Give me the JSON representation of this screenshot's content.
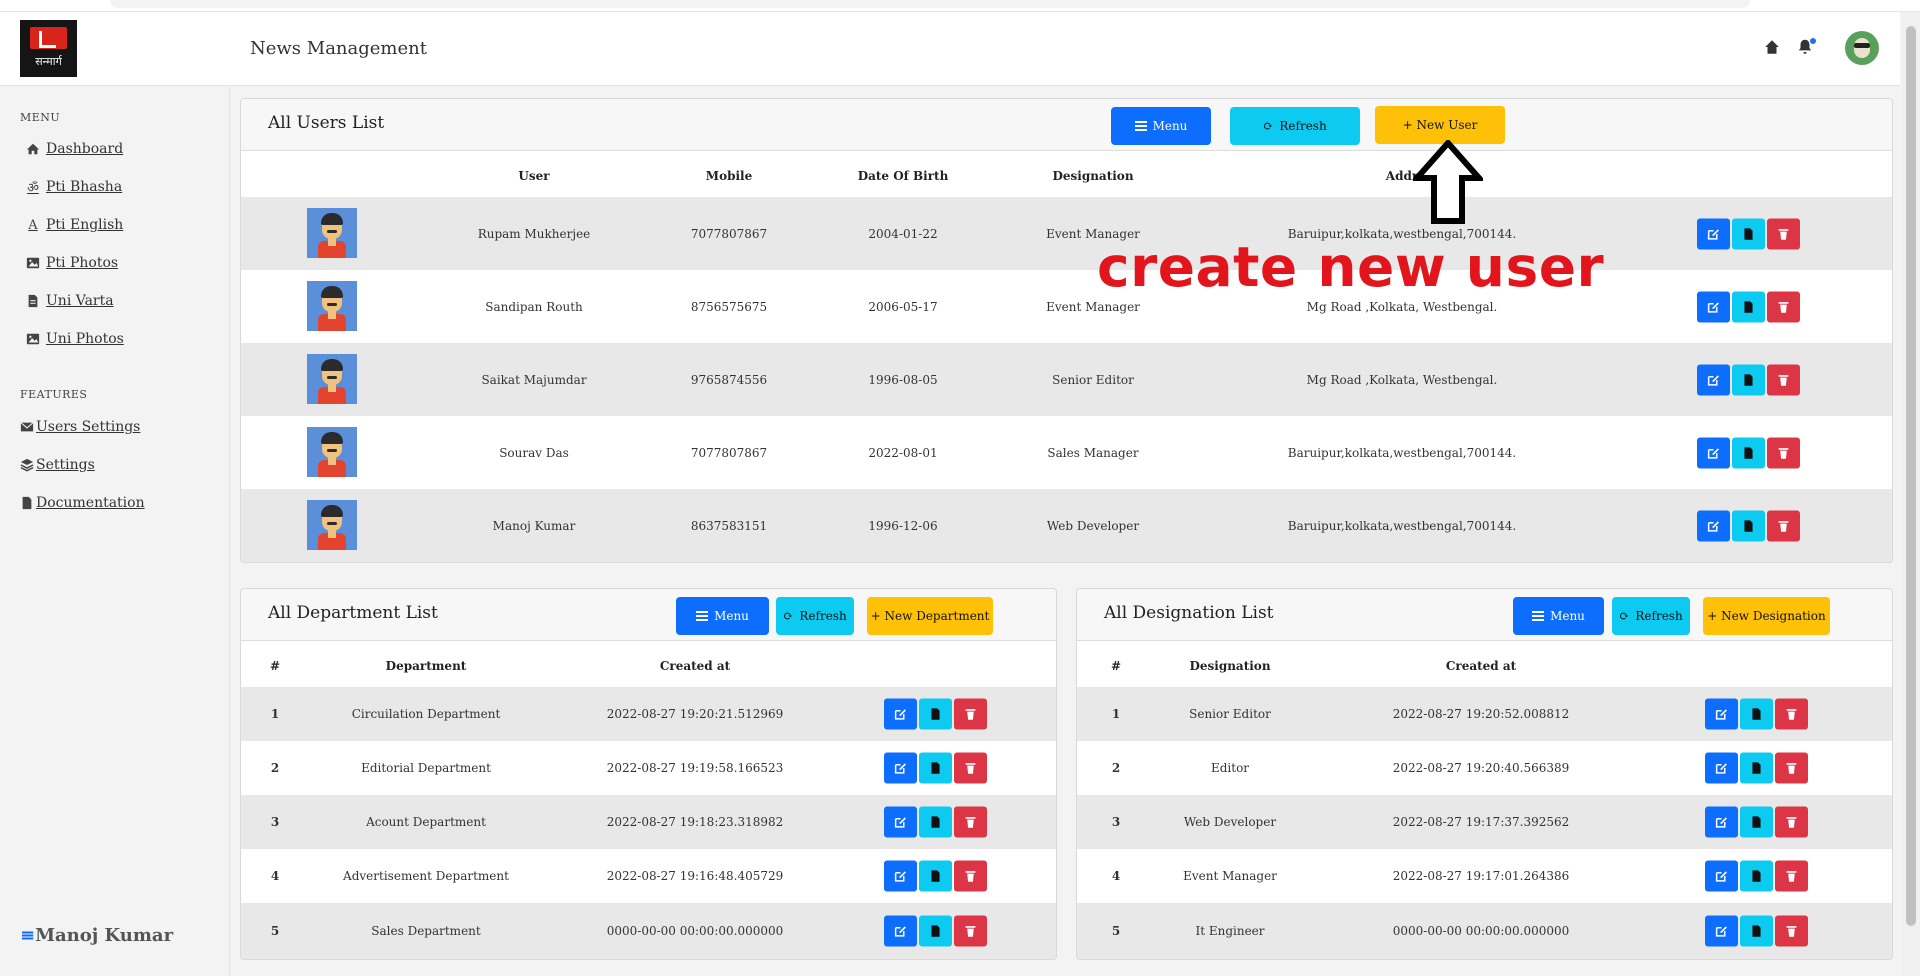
{
  "header": {
    "title": "News Management",
    "logo_text": "सन्मार्ग"
  },
  "sidebar": {
    "menu_label": "MENU",
    "menu_items": [
      {
        "label": "Dashboard",
        "icon": "home-icon"
      },
      {
        "label": "Pti Bhasha",
        "icon": "om-icon"
      },
      {
        "label": "Pti English",
        "icon": "letter-a-icon"
      },
      {
        "label": "Pti Photos",
        "icon": "image-icon"
      },
      {
        "label": "Uni Varta",
        "icon": "file-icon"
      },
      {
        "label": "Uni Photos",
        "icon": "image-icon"
      }
    ],
    "features_label": "FEATURES",
    "feature_items": [
      {
        "label": "Users Settings",
        "icon": "envelope-icon"
      },
      {
        "label": "Settings",
        "icon": "layers-icon"
      },
      {
        "label": "Documentation",
        "icon": "file-icon"
      }
    ],
    "footer_user": "Manoj Kumar",
    "footer_icon": "≡"
  },
  "users_card": {
    "title": "All Users List",
    "menu_btn": "Menu",
    "refresh_btn": "Refresh",
    "new_btn": "+ New User",
    "columns": [
      "User",
      "Mobile",
      "Date Of Birth",
      "Designation",
      "Addr"
    ],
    "rows": [
      {
        "name": "Rupam Mukherjee",
        "mobile": "7077807867",
        "dob": "2004-01-22",
        "designation": "Event Manager",
        "address": "Baruipur,kolkata,westbengal,700144."
      },
      {
        "name": "Sandipan Routh",
        "mobile": "8756575675",
        "dob": "2006-05-17",
        "designation": "Event Manager",
        "address": "Mg Road ,Kolkata, Westbengal."
      },
      {
        "name": "Saikat Majumdar",
        "mobile": "9765874556",
        "dob": "1996-08-05",
        "designation": "Senior Editor",
        "address": "Mg Road ,Kolkata, Westbengal."
      },
      {
        "name": "Sourav Das",
        "mobile": "7077807867",
        "dob": "2022-08-01",
        "designation": "Sales Manager",
        "address": "Baruipur,kolkata,westbengal,700144."
      },
      {
        "name": "Manoj Kumar",
        "mobile": "8637583151",
        "dob": "1996-12-06",
        "designation": "Web Developer",
        "address": "Baruipur,kolkata,westbengal,700144."
      }
    ]
  },
  "department_card": {
    "title": "All Department List",
    "menu_btn": "Menu",
    "refresh_btn": "Refresh",
    "new_btn": "+ New Department",
    "columns": [
      "#",
      "Department",
      "Created at"
    ],
    "rows": [
      {
        "num": "1",
        "name": "Circuilation Department",
        "created": "2022-08-27 19:20:21.512969"
      },
      {
        "num": "2",
        "name": "Editorial Department",
        "created": "2022-08-27 19:19:58.166523"
      },
      {
        "num": "3",
        "name": "Acount Department",
        "created": "2022-08-27 19:18:23.318982"
      },
      {
        "num": "4",
        "name": "Advertisement Department",
        "created": "2022-08-27 19:16:48.405729"
      },
      {
        "num": "5",
        "name": "Sales Department",
        "created": "0000-00-00 00:00:00.000000"
      }
    ]
  },
  "designation_card": {
    "title": "All Designation List",
    "menu_btn": "Menu",
    "refresh_btn": "Refresh",
    "new_btn": "+ New Designation",
    "columns": [
      "#",
      "Designation",
      "Created at"
    ],
    "rows": [
      {
        "num": "1",
        "name": "Senior Editor",
        "created": "2022-08-27 19:20:52.008812"
      },
      {
        "num": "2",
        "name": "Editor",
        "created": "2022-08-27 19:20:40.566389"
      },
      {
        "num": "3",
        "name": "Web Developer",
        "created": "2022-08-27 19:17:37.392562"
      },
      {
        "num": "4",
        "name": "Event Manager",
        "created": "2022-08-27 19:17:01.264386"
      },
      {
        "num": "5",
        "name": "It Engineer",
        "created": "0000-00-00 00:00:00.000000"
      }
    ]
  },
  "annotation": {
    "text": "create new user"
  },
  "colors": {
    "primary": "#0d6efd",
    "info": "#0dcaf0",
    "warning": "#ffc107",
    "danger": "#dc3545",
    "annotation": "#e2141c"
  }
}
